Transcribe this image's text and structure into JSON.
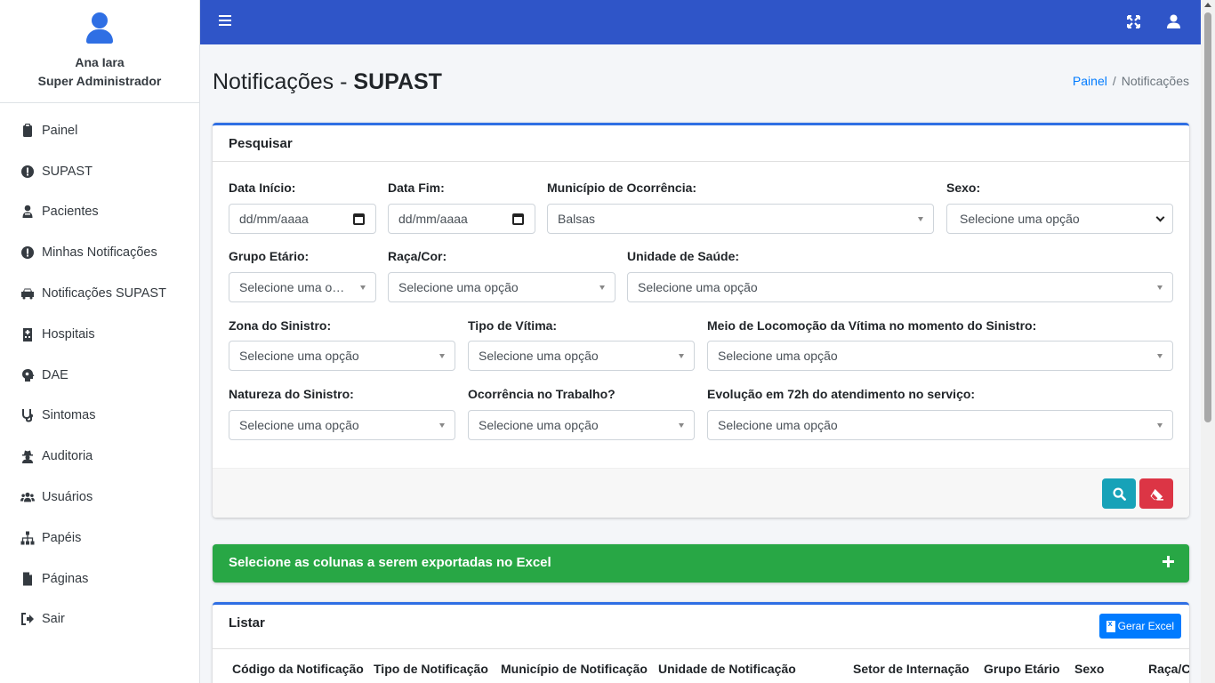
{
  "sidebar": {
    "user": {
      "name": "Ana Iara",
      "role": "Super Administrador"
    },
    "items": [
      {
        "label": "Painel",
        "icon": "clipboard-icon"
      },
      {
        "label": "SUPAST",
        "icon": "exclamation-circle-icon"
      },
      {
        "label": "Pacientes",
        "icon": "user-injured-icon"
      },
      {
        "label": "Minhas Notificações",
        "icon": "exclamation-circle-icon"
      },
      {
        "label": "Notificações SUPAST",
        "icon": "car-icon"
      },
      {
        "label": "Hospitais",
        "icon": "hospital-icon"
      },
      {
        "label": "DAE",
        "icon": "head-virus-icon"
      },
      {
        "label": "Sintomas",
        "icon": "stethoscope-icon"
      },
      {
        "label": "Auditoria",
        "icon": "user-secret-icon"
      },
      {
        "label": "Usuários",
        "icon": "users-icon"
      },
      {
        "label": "Papéis",
        "icon": "sitemap-icon"
      },
      {
        "label": "Páginas",
        "icon": "file-icon"
      },
      {
        "label": "Sair",
        "icon": "sign-out-icon"
      }
    ]
  },
  "header": {
    "title_prefix": "Notificações - ",
    "title_bold": "SUPAST",
    "breadcrumb": {
      "home": "Painel",
      "current": "Notificações"
    }
  },
  "search": {
    "title": "Pesquisar",
    "fields": {
      "data_inicio": {
        "label": "Data Início:",
        "value": "dd/mm/aaaa"
      },
      "data_fim": {
        "label": "Data Fim:",
        "value": "dd/mm/aaaa"
      },
      "municipio": {
        "label": "Município de Ocorrência:",
        "value": "Balsas"
      },
      "sexo": {
        "label": "Sexo:",
        "value": "Selecione uma opção"
      },
      "grupo_etario": {
        "label": "Grupo Etário:",
        "value": "Selecione uma opção"
      },
      "raca_cor": {
        "label": "Raça/Cor:",
        "value": "Selecione uma opção"
      },
      "unidade_saude": {
        "label": "Unidade de Saúde:",
        "value": "Selecione uma opção"
      },
      "zona_sinistro": {
        "label": "Zona do Sinistro:",
        "value": "Selecione uma opção"
      },
      "tipo_vitima": {
        "label": "Tipo de Vítima:",
        "value": "Selecione uma opção"
      },
      "meio_locomocao": {
        "label": "Meio de Locomoção da Vítima no momento do Sinistro:",
        "value": "Selecione uma opção"
      },
      "natureza_sinistro": {
        "label": "Natureza do Sinistro:",
        "value": "Selecione uma opção"
      },
      "ocorrencia_trabalho": {
        "label": "Ocorrência no Trabalho?",
        "value": "Selecione uma opção"
      },
      "evolucao_72h": {
        "label": "Evolução em 72h do atendimento no serviço:",
        "value": "Selecione uma opção"
      }
    }
  },
  "export": {
    "title": "Selecione as colunas a serem exportadas no Excel"
  },
  "list": {
    "title": "Listar",
    "excel_button": "Gerar Excel",
    "columns": [
      "Código da Notificação",
      "Tipo de Notificação",
      "Município de Notificação",
      "Unidade de Notificação",
      "Setor de Internação",
      "Grupo Etário",
      "Sexo",
      "Raça/Cor"
    ]
  },
  "colors": {
    "topbar": "#2f55c8",
    "primary": "#2f6fe4",
    "success": "#28a745",
    "info": "#17a2b8",
    "danger": "#dc3545",
    "link": "#007bff"
  }
}
